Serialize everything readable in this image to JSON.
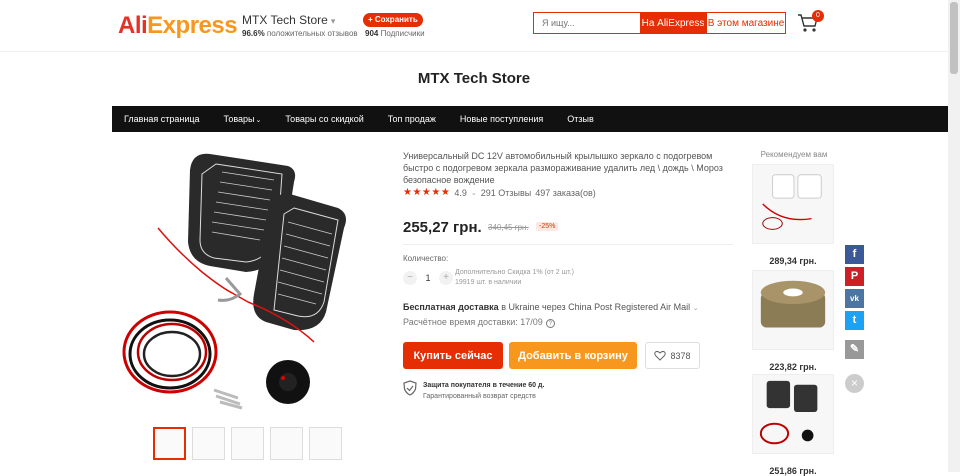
{
  "header": {
    "logo": "AliExpress",
    "store_name": "MTX Tech Store",
    "positive_feedback": "96.6%",
    "positive_feedback_label": "положительных отзывов",
    "follow_label": "+ Сохранить",
    "subscribers": "904",
    "subscribers_label": "Подписчики",
    "search_placeholder": "Я ищу...",
    "search_aliexpress": "На AliExpress",
    "search_store": "В этом магазине",
    "cart_count": "0"
  },
  "banner": {
    "title": "MTX Tech Store"
  },
  "nav": {
    "items": [
      {
        "label": "Главная страница"
      },
      {
        "label": "Товары",
        "dropdown": true
      },
      {
        "label": "Товары со скидкой"
      },
      {
        "label": "Топ продаж"
      },
      {
        "label": "Новые поступления"
      },
      {
        "label": "Отзыв"
      }
    ]
  },
  "product": {
    "title": "Универсальный DC 12V автомобильный крылышко зеркало с подогревом быстро с подогревом зеркала размораживание удалить лед \\ дождь \\ Мороз безопасное вождение",
    "rating": "4.9",
    "reviews": "291 Отзывы",
    "orders": "497 заказа(ов)",
    "price": "255,27 грн.",
    "old_price": "340,45 грн.",
    "discount": "-25%",
    "quantity_label": "Количество:",
    "quantity": "1",
    "qty_note_1": "Дополнительно Скидка 1% (от 2 шт.)",
    "qty_note_2": "19919 шт. в наличии",
    "shipping_free": "Бесплатная доставка",
    "shipping_rest": "в Ukraine через China Post Registered Air Mail",
    "delivery_time": "Расчётное время доставки: 17/09",
    "buy_now": "Купить сейчас",
    "add_to_cart": "Добавить в корзину",
    "wishlist_count": "8378",
    "protection_title": "Защита покупателя в течение 60 д.",
    "protection_sub": "Гарантированный возврат средств"
  },
  "recommended": {
    "title": "Рекомендуем вам",
    "items": [
      {
        "price": "289,34 грн."
      },
      {
        "price": "223,82 грн."
      },
      {
        "price": "251,86 грн."
      }
    ]
  },
  "social": {
    "facebook_color": "#3b5998",
    "pinterest_color": "#cb2027",
    "vk_color": "#4c75a3",
    "twitter_color": "#1da1f2",
    "edit_color": "#999999"
  },
  "colors": {
    "accent": "#e62e04",
    "orange": "#f7971d"
  }
}
